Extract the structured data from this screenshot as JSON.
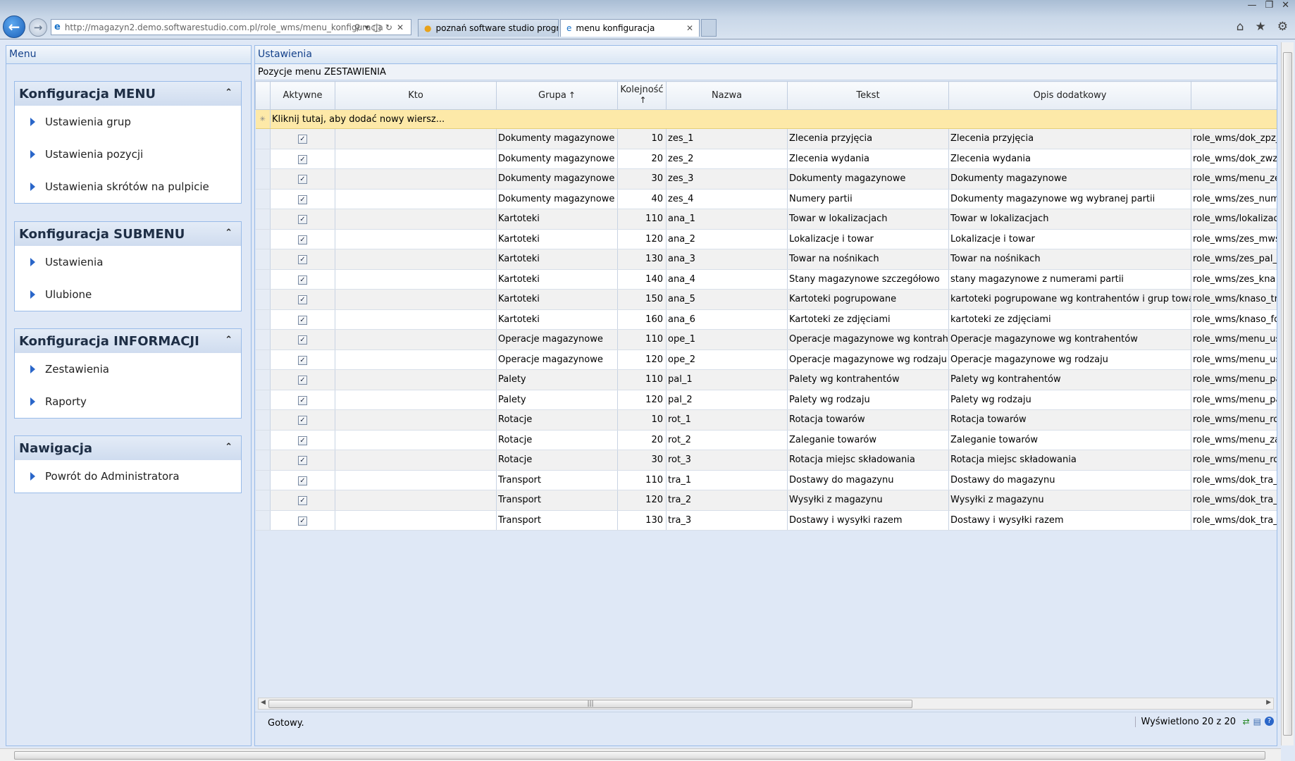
{
  "browser": {
    "url": "http://magazyn2.demo.softwarestudio.com.pl/role_wms/menu_konfiguracja",
    "tabs": [
      {
        "label": "poznań software studio progra..."
      },
      {
        "label": "menu konfiguracja"
      }
    ]
  },
  "left": {
    "header": "Menu",
    "sections": [
      {
        "title": "Konfiguracja MENU",
        "items": [
          "Ustawienia grup",
          "Ustawienia pozycji",
          "Ustawienia skrótów na pulpicie"
        ]
      },
      {
        "title": "Konfiguracja SUBMENU",
        "items": [
          "Ustawienia",
          "Ulubione"
        ]
      },
      {
        "title": "Konfiguracja INFORMACJI",
        "items": [
          "Zestawienia",
          "Raporty"
        ]
      },
      {
        "title": "Nawigacja",
        "items": [
          "Powrót do Administratora"
        ]
      }
    ]
  },
  "right": {
    "header": "Ustawienia",
    "subheader": "Pozycje menu ZESTAWIENIA",
    "columns": {
      "aktywne": "Aktywne",
      "kto": "Kto",
      "grupa": "Grupa",
      "kolejnosc": "Kolejność",
      "nazwa": "Nazwa",
      "tekst": "Tekst",
      "opis": "Opis dodatkowy"
    },
    "new_row_text": "Kliknij tutaj, aby dodać nowy wiersz...",
    "rows": [
      {
        "grupa": "Dokumenty magazynowe",
        "kolejnosc": "10",
        "nazwa": "zes_1",
        "tekst": "Zlecenia przyjęcia",
        "opis": "Zlecenia przyjęcia",
        "url": "role_wms/dok_zpz_"
      },
      {
        "grupa": "Dokumenty magazynowe",
        "kolejnosc": "20",
        "nazwa": "zes_2",
        "tekst": "Zlecenia wydania",
        "opis": "Zlecenia wydania",
        "url": "role_wms/dok_zwz"
      },
      {
        "grupa": "Dokumenty magazynowe",
        "kolejnosc": "30",
        "nazwa": "zes_3",
        "tekst": "Dokumenty magazynowe",
        "opis": "Dokumenty magazynowe",
        "url": "role_wms/menu_ze"
      },
      {
        "grupa": "Dokumenty magazynowe",
        "kolejnosc": "40",
        "nazwa": "zes_4",
        "tekst": "Numery partii",
        "opis": "Dokumenty magazynowe wg wybranej partii",
        "url": "role_wms/zes_num"
      },
      {
        "grupa": "Kartoteki",
        "kolejnosc": "110",
        "nazwa": "ana_1",
        "tekst": "Towar w lokalizacjach",
        "opis": "Towar w lokalizacjach",
        "url": "role_wms/lokalizac"
      },
      {
        "grupa": "Kartoteki",
        "kolejnosc": "120",
        "nazwa": "ana_2",
        "tekst": "Lokalizacje i towar",
        "opis": "Lokalizacje i towar",
        "url": "role_wms/zes_mws"
      },
      {
        "grupa": "Kartoteki",
        "kolejnosc": "130",
        "nazwa": "ana_3",
        "tekst": "Towar na nośnikach",
        "opis": "Towar na nośnikach",
        "url": "role_wms/zes_pal_"
      },
      {
        "grupa": "Kartoteki",
        "kolejnosc": "140",
        "nazwa": "ana_4",
        "tekst": "Stany magazynowe szczegółowo",
        "opis": "stany magazynowe z numerami partii",
        "url": "role_wms/zes_kna"
      },
      {
        "grupa": "Kartoteki",
        "kolejnosc": "150",
        "nazwa": "ana_5",
        "tekst": "Kartoteki pogrupowane",
        "opis": "kartoteki pogrupowane wg kontrahentów i grup towa",
        "url": "role_wms/knaso_tr"
      },
      {
        "grupa": "Kartoteki",
        "kolejnosc": "160",
        "nazwa": "ana_6",
        "tekst": "Kartoteki ze zdjęciami",
        "opis": "kartoteki ze zdjęciami",
        "url": "role_wms/knaso_fo"
      },
      {
        "grupa": "Operacje magazynowe",
        "kolejnosc": "110",
        "nazwa": "ope_1",
        "tekst": "Operacje magazynowe wg kontrahe",
        "opis": "Operacje magazynowe wg kontrahentów",
        "url": "role_wms/menu_us"
      },
      {
        "grupa": "Operacje magazynowe",
        "kolejnosc": "120",
        "nazwa": "ope_2",
        "tekst": "Operacje magazynowe wg rodzaju",
        "opis": "Operacje magazynowe wg rodzaju",
        "url": "role_wms/menu_us"
      },
      {
        "grupa": "Palety",
        "kolejnosc": "110",
        "nazwa": "pal_1",
        "tekst": "Palety wg kontrahentów",
        "opis": "Palety wg kontrahentów",
        "url": "role_wms/menu_pa"
      },
      {
        "grupa": "Palety",
        "kolejnosc": "120",
        "nazwa": "pal_2",
        "tekst": "Palety wg rodzaju",
        "opis": "Palety wg rodzaju",
        "url": "role_wms/menu_pa"
      },
      {
        "grupa": "Rotacje",
        "kolejnosc": "10",
        "nazwa": "rot_1",
        "tekst": "Rotacja towarów",
        "opis": "Rotacja towarów",
        "url": "role_wms/menu_ro"
      },
      {
        "grupa": "Rotacje",
        "kolejnosc": "20",
        "nazwa": "rot_2",
        "tekst": "Zaleganie towarów",
        "opis": "Zaleganie towarów",
        "url": "role_wms/menu_za"
      },
      {
        "grupa": "Rotacje",
        "kolejnosc": "30",
        "nazwa": "rot_3",
        "tekst": "Rotacja miejsc składowania",
        "opis": "Rotacja miejsc składowania",
        "url": "role_wms/menu_ro"
      },
      {
        "grupa": "Transport",
        "kolejnosc": "110",
        "nazwa": "tra_1",
        "tekst": "Dostawy do magazynu",
        "opis": "Dostawy do magazynu",
        "url": "role_wms/dok_tra_"
      },
      {
        "grupa": "Transport",
        "kolejnosc": "120",
        "nazwa": "tra_2",
        "tekst": "Wysyłki z magazynu",
        "opis": "Wysyłki z magazynu",
        "url": "role_wms/dok_tra_"
      },
      {
        "grupa": "Transport",
        "kolejnosc": "130",
        "nazwa": "tra_3",
        "tekst": "Dostawy i wysyłki razem",
        "opis": "Dostawy i wysyłki razem",
        "url": "role_wms/dok_tra_"
      }
    ],
    "status_text": "Gotowy.",
    "count_text": "Wyświetlono 20 z 20"
  }
}
